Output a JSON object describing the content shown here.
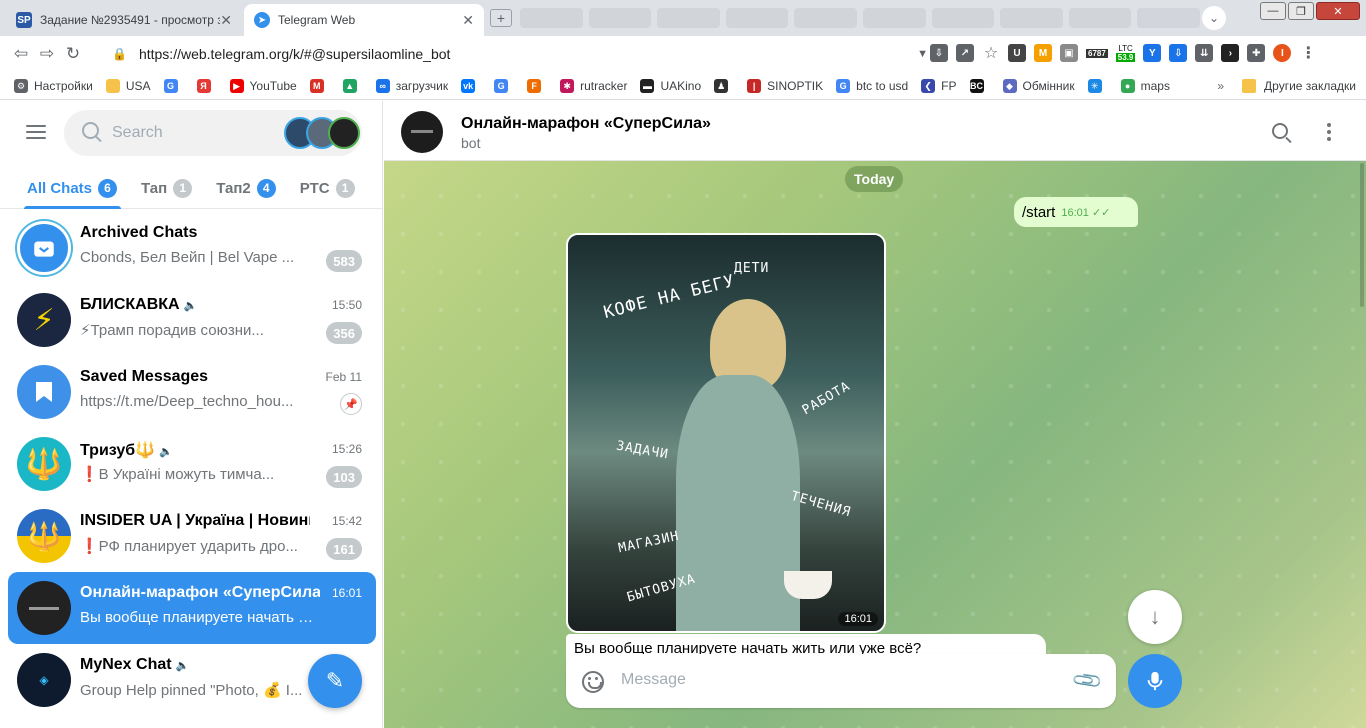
{
  "browser": {
    "tabs": [
      {
        "title": "Задание №2935491 - просмотр з",
        "favicon": "SP",
        "active": false
      },
      {
        "title": "Telegram Web",
        "favicon": "tg",
        "active": true
      }
    ],
    "url": "https://web.telegram.org/k/#@supersilaomline_bot",
    "ext_ltc": {
      "label": "LTC",
      "value": "53.9",
      "btc": "6787"
    },
    "bookmarks": [
      "Настройки",
      "USA",
      "YouTube",
      "загрузчик",
      "rutracker",
      "UAKino",
      "SINOPTIK",
      "btc to usd",
      "FP",
      "Обмінник",
      "maps"
    ],
    "bookmarks_right": "Другие закладки"
  },
  "left": {
    "search_placeholder": "Search",
    "folders": [
      {
        "label": "All Chats",
        "count": "6",
        "active": true
      },
      {
        "label": "Тап",
        "count": "1",
        "active": false
      },
      {
        "label": "Тап2",
        "count": "4",
        "active": false
      },
      {
        "label": "РТС",
        "count": "1",
        "active": false
      }
    ],
    "chats": [
      {
        "title": "Archived Chats",
        "time": "",
        "preview": "Cbonds, Бел Вейп | Bel Vape ...",
        "badge": "583",
        "muted": false,
        "avatar": "archive",
        "color": "#3390ec"
      },
      {
        "title": "БЛИСКАВКА",
        "time": "15:50",
        "preview": "⚡Трамп порадив союзни...",
        "badge": "356",
        "muted": true,
        "avatar": "⚡",
        "color": "#1b2740"
      },
      {
        "title": "Saved Messages",
        "time": "Feb 11",
        "preview": "https://t.me/Deep_techno_hou...",
        "badge": "",
        "muted": false,
        "avatar": "saved",
        "color": "#3e90e8"
      },
      {
        "title": "Тризуб🔱",
        "time": "15:26",
        "preview": "❗В Україні можуть тимча...",
        "badge": "103",
        "muted": true,
        "avatar": "🔱",
        "color": "#1ab7c7"
      },
      {
        "title": "INSIDER UA | Україна | Новини",
        "time": "15:42",
        "preview": "❗РФ планирует ударить дро...",
        "badge": "161",
        "muted": true,
        "avatar": "🔱",
        "color": "#2a6bc4"
      },
      {
        "title": "Онлайн-марафон «СуперСила»",
        "time": "16:01",
        "preview": "Вы вообще планируете начать жит...",
        "badge": "",
        "muted": false,
        "avatar": "dark",
        "color": "#222222",
        "selected": true
      },
      {
        "title": "MyNex Chat",
        "time": "",
        "preview": "Group Help pinned \"Photo, 💰 I...",
        "badge": "",
        "muted": true,
        "avatar": "nex",
        "color": "#0e1a2e"
      }
    ]
  },
  "right": {
    "chat_name": "Онлайн-марафон «СуперСила»",
    "chat_status": "bot",
    "date_chip": "Today",
    "out_message": {
      "text": "/start",
      "time": "16:01"
    },
    "photo_time": "16:01",
    "photo_words": [
      "КОФЕ НА БЕГУ",
      "ДЕТИ",
      "РАБОТА",
      "ЗАДАЧИ",
      "ТЕЧЕНИЯ",
      "МАГАЗИН",
      "БЫТОВУХА"
    ],
    "in_message": "Вы вообще планируете начать жить или уже всё?",
    "composer_placeholder": "Message"
  }
}
